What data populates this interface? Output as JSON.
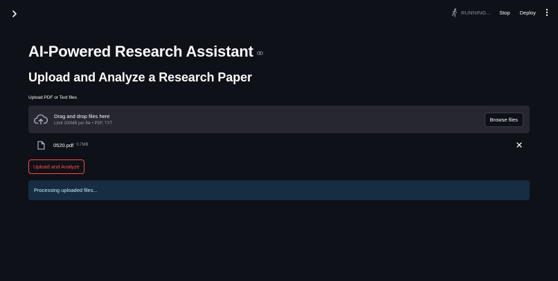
{
  "header": {
    "status_text": "RUNNING...",
    "stop_label": "Stop",
    "deploy_label": "Deploy"
  },
  "main": {
    "title": "AI-Powered Research Assistant",
    "subheader": "Upload and Analyze a Research Paper",
    "uploader": {
      "label": "Upload PDF or Text files",
      "drop_text": "Drag and drop files here",
      "limit_text": "Limit 200MB per file • PDF, TXT",
      "browse_label": "Browse files"
    },
    "uploaded_file": {
      "name": "0520.pdf",
      "size": "0.7MB"
    },
    "action_button": "Upload and Analyze",
    "status_message": "Processing uploaded files..."
  },
  "colors": {
    "background": "#0e1117",
    "dropzone": "#262730",
    "accent": "#ff4b4b",
    "info_bg": "#172d43",
    "info_text": "#c7ebff"
  },
  "icons": [
    "chevron-right-icon",
    "running-figure-icon",
    "vertical-dots-icon",
    "link-icon",
    "cloud-upload-icon",
    "file-icon",
    "close-icon"
  ]
}
